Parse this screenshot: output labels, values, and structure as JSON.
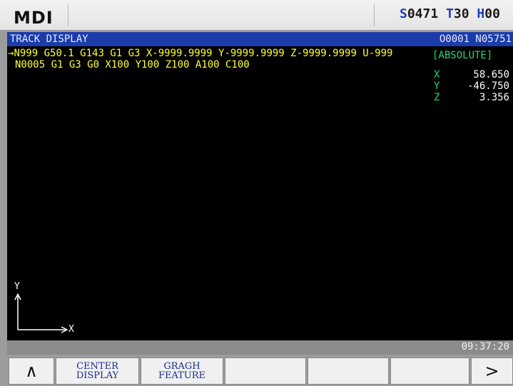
{
  "header": {
    "mode": "MDI",
    "spindle_letter": "S",
    "spindle_value": "0471",
    "tool_letter": "T",
    "tool_value": "30",
    "h_letter": "H",
    "h_value": "00"
  },
  "title_bar": {
    "title": "TRACK DISPLAY",
    "program": "O0001 N05751"
  },
  "program_lines": [
    "N999 G50.1 G143 G1 G3 X-9999.9999 Y-9999.9999 Z-9999.9999 U-999",
    "N0005 G1 G3 G0 X100 Y100 Z100 A100 C100"
  ],
  "cursor_arrow": "→",
  "coordinates": {
    "mode": "[ABSOLUTE]",
    "axes": [
      {
        "name": "X",
        "value": "58.650"
      },
      {
        "name": "Y",
        "value": "-46.750"
      },
      {
        "name": "Z",
        "value": "3.356"
      }
    ]
  },
  "plot_axes": {
    "x_label": "X",
    "y_label": "Y"
  },
  "status_bar": {
    "time": "09:37:20"
  },
  "softkeys": {
    "prev": "∧",
    "center_display": "CENTER\nDISPLAY",
    "graph_feature": "GRAGH\nFEATURE",
    "next": ">"
  },
  "colors": {
    "title_bar": "#1c3caa",
    "code_text": "#ffff33",
    "coord_label": "#22d86a",
    "status_letter": "#1d3dbf"
  }
}
